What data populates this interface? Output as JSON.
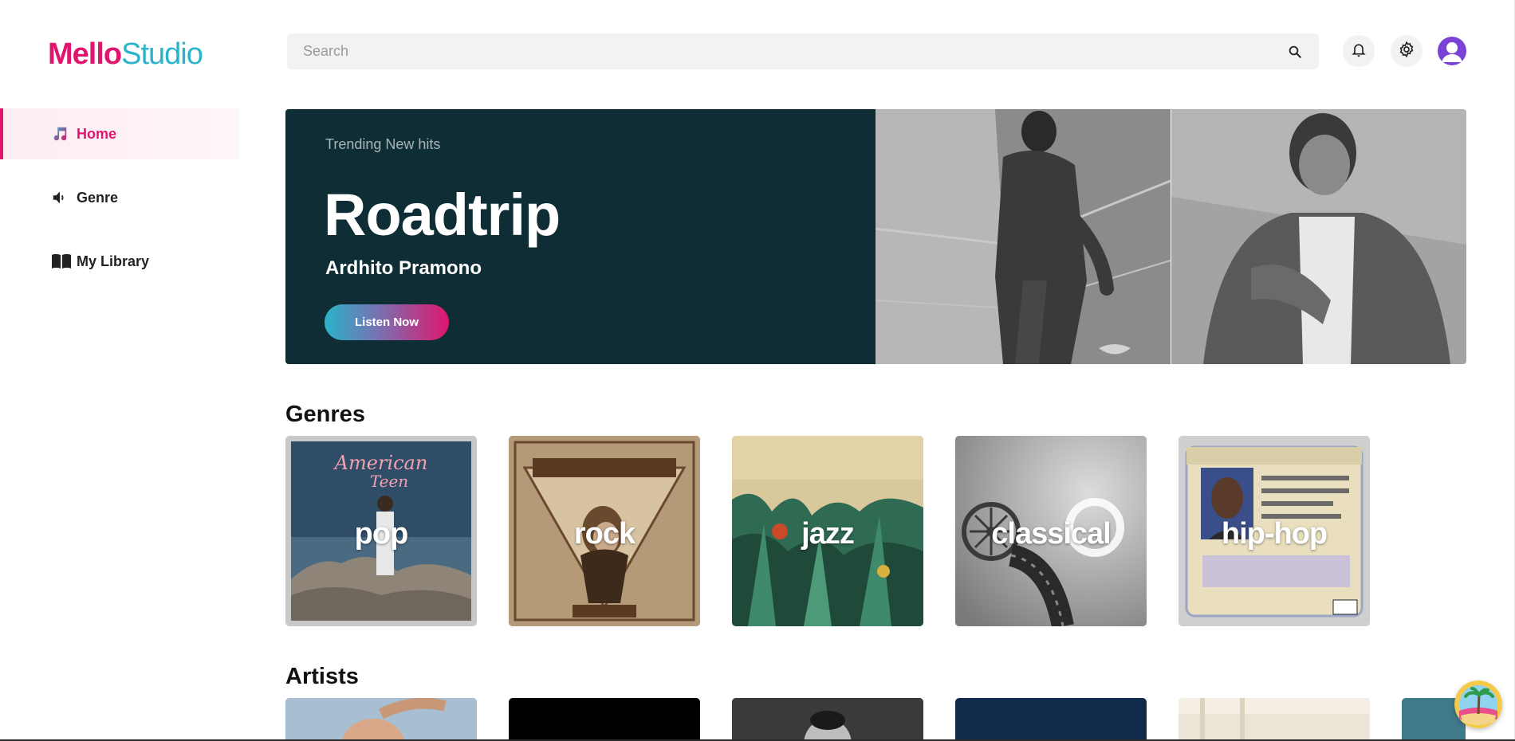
{
  "app": {
    "logo_part1": "Mello",
    "logo_part2": "Studio",
    "brand_color": "#e0166e",
    "accent_color": "#2bb3c9"
  },
  "sidebar": {
    "items": [
      {
        "label": "Home",
        "icon": "music-note-icon",
        "active": true
      },
      {
        "label": "Genre",
        "icon": "speaker-icon",
        "active": false
      },
      {
        "label": "My Library",
        "icon": "book-icon",
        "active": false
      }
    ]
  },
  "topbar": {
    "search_placeholder": "Search",
    "search_value": "",
    "icons": [
      "search-icon",
      "bell-icon",
      "gear-icon",
      "user-avatar-icon"
    ]
  },
  "hero": {
    "eyebrow": "Trending New hits",
    "title": "Roadtrip",
    "artist": "Ardhito Pramono",
    "button_label": "Listen Now",
    "background_color": "#0f2d35"
  },
  "genres": {
    "title": "Genres",
    "items": [
      {
        "label": "pop"
      },
      {
        "label": "rock"
      },
      {
        "label": "jazz"
      },
      {
        "label": "classical"
      },
      {
        "label": "hip-hop"
      }
    ]
  },
  "artists": {
    "title": "Artists"
  }
}
